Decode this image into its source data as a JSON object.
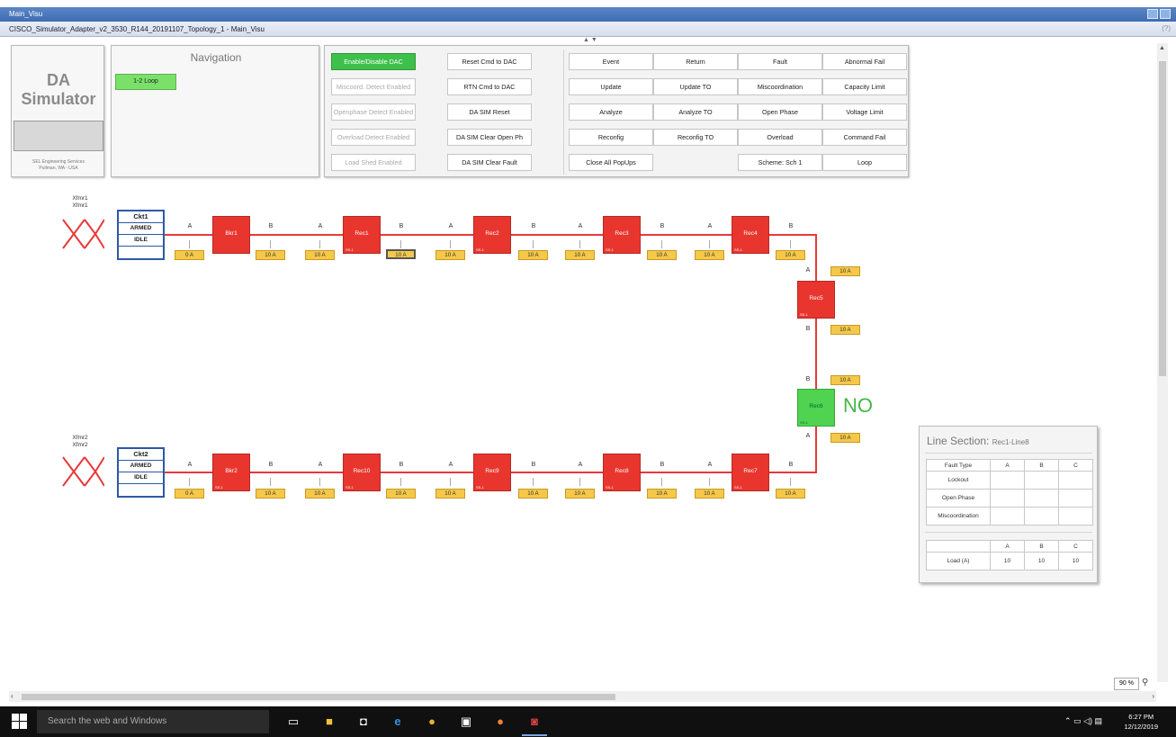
{
  "window": {
    "title": "Main_Visu",
    "subtitle": "CISCO_Simulator_Adapter_v2_3530_R144_20191107_Topology_1 - Main_Visu",
    "help": "(?)"
  },
  "logo": {
    "title": "DA Simulator",
    "footer_line1": "SEL Engineering Services",
    "footer_line2": "Pullman, WA - USA"
  },
  "navigation": {
    "title": "Navigation",
    "loop_button": "1-2 Loop"
  },
  "commands": {
    "col1": [
      "Enable/Disable DAC",
      "Miscoord. Detect Enabled",
      "Openphase Detect Enabled",
      "Overload Detect Enabled",
      "Load Shed Enabled"
    ],
    "col2": [
      "Reset Cmd to DAC",
      "RTN Cmd to DAC",
      "DA SIM Reset",
      "DA SIM Clear Open Ph",
      "DA SIM Clear Fault"
    ],
    "col3": [
      "Event",
      "Update",
      "Analyze",
      "Reconfig",
      "Close All PopUps"
    ],
    "col4": [
      "Return",
      "Update TO",
      "Analyze TO",
      "Reconfig TO"
    ],
    "col5": [
      "Fault",
      "Miscoordination",
      "Open Phase",
      "Overload",
      "Scheme: Sch 1"
    ],
    "col6": [
      "Abnormal Fail",
      "Capacity Limit",
      "Voltage Limit",
      "Command Fail",
      "Loop"
    ]
  },
  "diagram": {
    "xfmr1": [
      "Xfmr1",
      "Xfmr1"
    ],
    "xfmr2": [
      "Xfmr2",
      "Xfmr2"
    ],
    "ckt1": [
      "Ckt1",
      "ARMED",
      "IDLE",
      ""
    ],
    "ckt2": [
      "Ckt2",
      "ARMED",
      "IDLE",
      ""
    ],
    "top_devices": [
      "Bkr1",
      "Rec1",
      "Rec2",
      "Rec3",
      "Rec4"
    ],
    "bottom_devices": [
      "Bkr2",
      "Rec10",
      "Rec9",
      "Rec8",
      "Rec7"
    ],
    "right_devices": [
      "Rec5",
      "Rec6"
    ],
    "device_sub": "SS-1",
    "phase_a": "A",
    "phase_b": "B",
    "top_currents": [
      "0 A",
      "10 A",
      "10 A",
      "10 A",
      "10 A",
      "10 A",
      "10 A",
      "10 A",
      "10 A",
      "10 A"
    ],
    "bottom_currents": [
      "0 A",
      "10 A",
      "10 A",
      "10 A",
      "10 A",
      "10 A",
      "10 A",
      "10 A",
      "10 A",
      "10 A"
    ],
    "right_currents": [
      "10 A",
      "10 A",
      "10 A",
      "10 A"
    ],
    "no_label": "NO"
  },
  "line_section": {
    "title": "Line Section:",
    "name": "Rec1-Line8",
    "fault_header": [
      "Fault Type",
      "A",
      "B",
      "C"
    ],
    "fault_rows": [
      "Lockout",
      "Open Phase",
      "Miscoordination"
    ],
    "load_header": [
      "",
      "A",
      "B",
      "C"
    ],
    "load_row": [
      "Load (A)",
      "10",
      "10",
      "10"
    ]
  },
  "zoom": "90 %",
  "taskbar": {
    "search": "Search the web and Windows",
    "time": "6:27 PM",
    "date": "12/12/2019"
  }
}
